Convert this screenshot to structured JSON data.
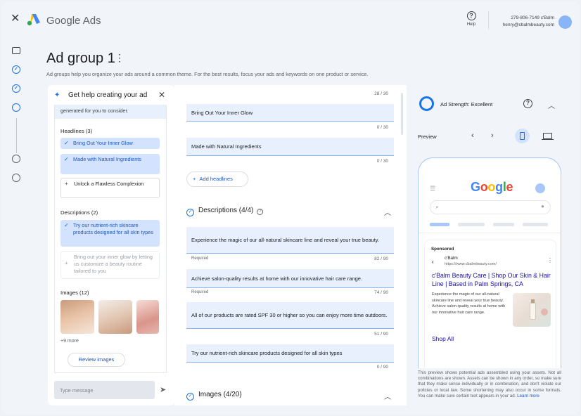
{
  "app": {
    "brand": "Google Ads"
  },
  "header": {
    "help_label": "Help",
    "account_phone": "279-806-7149 c'Balm",
    "account_email": "henry@cbalmbeauty.com"
  },
  "page": {
    "title": "Ad group 1",
    "description": "Ad groups help you organize your ads around a common theme. For the best results, focus your ads and keywords on one product or service."
  },
  "assistant": {
    "title": "Get help creating your ad",
    "generated_text": "generated for you to consider.",
    "headlines_label": "Headlines (3)",
    "headlines": [
      {
        "text": "Bring Out Your Inner Glow",
        "state": "selected"
      },
      {
        "text": "Made with Natural Ingredients",
        "state": "selected"
      },
      {
        "text": "Unlock a Flawless Complexion",
        "state": "unselected"
      }
    ],
    "descriptions_label": "Descriptions (2)",
    "descriptions": [
      {
        "text": "Try our nutrient-rich skincare products designed for all skin types",
        "state": "selected"
      },
      {
        "text": "Bring out your inner glow by letting us customize a beauty routine tailored to you",
        "state": "faded"
      }
    ],
    "images_label": "Images (12)",
    "more_label": "+9 more",
    "review_button": "Review images",
    "message_placeholder": "Type message"
  },
  "editor": {
    "top_counter": "28 / 30",
    "headlines": [
      {
        "text": "Bring Out Your Inner Glow",
        "counter": "0 / 30"
      },
      {
        "text": "Made with Natural Ingredients",
        "counter": "0 / 30"
      }
    ],
    "add_headlines": "Add headlines",
    "descriptions_title": "Descriptions (4/4)",
    "descriptions": [
      {
        "text": "Experience the magic of our all-natural skincare line and reveal your true beauty.",
        "required": "Required",
        "counter": "82 / 90"
      },
      {
        "text": "Achieve salon-quality results at home with our innovative hair care range.",
        "required": "Required",
        "counter": "74 / 90"
      },
      {
        "text": "All of our products are rated SPF 30 or higher so you can enjoy more time outdoors.",
        "required": "",
        "counter": "51 / 90"
      },
      {
        "text": "Try our nutrient-rich skincare products designed for all skin types",
        "required": "",
        "counter": "0 / 90"
      }
    ],
    "images_title": "Images (4/20)"
  },
  "preview_panel": {
    "ad_strength": "Ad Strength: Excellent",
    "preview_label": "Preview",
    "search_logo": "Google",
    "sponsored": "Sponsored",
    "advertiser_name": "c'Balm",
    "advertiser_url": "https://www.cbalmbeauty.com/",
    "ad_headline": "c'Balm Beauty Care | Shop Our Skin & Hair Line | Based in Palm Springs, CA",
    "ad_body": "Experience the magic of our all-natural skincare line and reveal your true beauty. Achieve salon-quality results at home with our innovative hair care range.",
    "shop_all": "Shop All",
    "disclaimer": "This preview shows potential ads assembled using your assets. Not all combinations are shown. Assets can be shown in any order, so make sure that they make sense individually or in combination, and don't violate our policies or local law. Some shortening may also occur in some formats. You can make sure certain text appears in your ad.",
    "learn_more": "Learn more"
  },
  "colors": {
    "accent": "#1a73e8",
    "selected_chip": "#d3e3fd",
    "field_bg": "#e8f0fe",
    "ad_link": "#1a0dab"
  }
}
